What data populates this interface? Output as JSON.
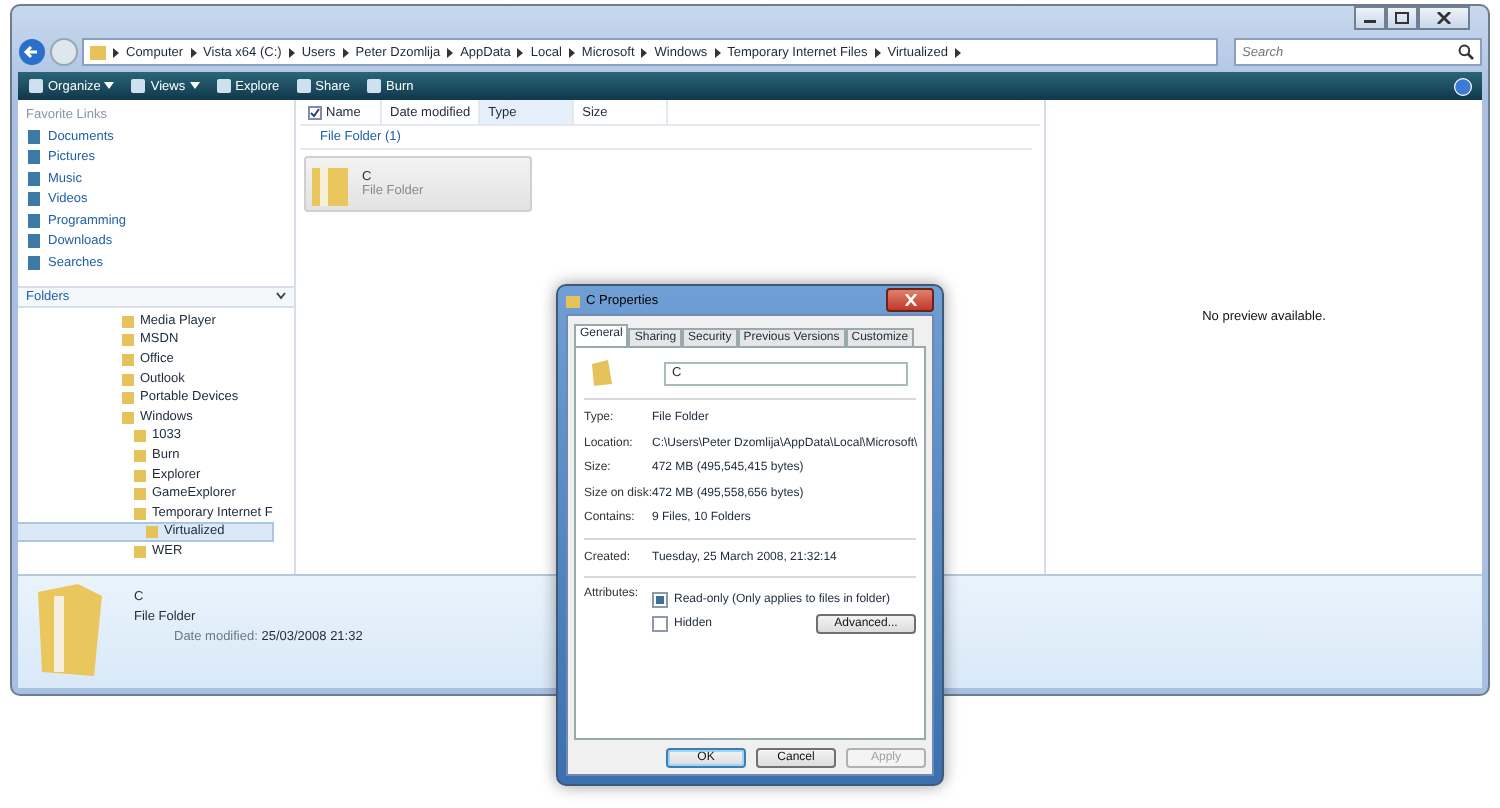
{
  "window": {
    "breadcrumbs": [
      "Computer",
      "Vista x64 (C:)",
      "Users",
      "Peter Dzomlija",
      "AppData",
      "Local",
      "Microsoft",
      "Windows",
      "Temporary Internet Files",
      "Virtualized"
    ],
    "search": {
      "placeholder": "Search"
    }
  },
  "toolbar": [
    {
      "label": "Organize",
      "dropdown": true
    },
    {
      "label": "Views",
      "dropdown": true
    },
    {
      "label": "Explore",
      "dropdown": false
    },
    {
      "label": "Share",
      "dropdown": false
    },
    {
      "label": "Burn",
      "dropdown": false
    }
  ],
  "sidebar": {
    "favorites_title": "Favorite Links",
    "favorites": [
      "Documents",
      "Pictures",
      "Music",
      "Videos",
      "Programming",
      "Downloads",
      "Searches"
    ],
    "folders_title": "Folders",
    "folders": [
      {
        "label": "Media Player",
        "selected": false
      },
      {
        "label": "MSDN",
        "selected": false
      },
      {
        "label": "Office",
        "selected": false
      },
      {
        "label": "Outlook",
        "selected": false
      },
      {
        "label": "Portable Devices",
        "selected": false
      },
      {
        "label": "Windows",
        "selected": false,
        "children": [
          {
            "label": "1033",
            "selected": false
          },
          {
            "label": "Burn",
            "selected": false
          },
          {
            "label": "Explorer",
            "selected": false
          },
          {
            "label": "GameExplorer",
            "selected": false
          },
          {
            "label": "Temporary Internet F",
            "selected": false,
            "children": [
              {
                "label": "Virtualized",
                "selected": true
              }
            ]
          },
          {
            "label": "WER",
            "selected": false
          }
        ]
      }
    ]
  },
  "table": {
    "columns": [
      {
        "label": "Name",
        "sorted": false
      },
      {
        "label": "Date modified",
        "sorted": false
      },
      {
        "label": "Type",
        "sorted": true
      },
      {
        "label": "Size",
        "sorted": false
      }
    ],
    "group": "File Folder (1)",
    "items": [
      {
        "name": "C",
        "type": "File Folder",
        "selected": true
      }
    ]
  },
  "preview": "No preview available.",
  "details": {
    "name": "C",
    "type": "File Folder",
    "date_label": "Date modified:",
    "date": "25/03/2008 21:32"
  },
  "dialog": {
    "title": "C Properties",
    "tabs": [
      {
        "label": "General",
        "selected": true
      },
      {
        "label": "Sharing",
        "selected": false
      },
      {
        "label": "Security",
        "selected": false
      },
      {
        "label": "Previous Versions",
        "selected": false
      },
      {
        "label": "Customize",
        "selected": false
      }
    ],
    "name_value": "C",
    "sections": [
      [
        {
          "label": "Type:",
          "value": "File Folder"
        },
        {
          "label": "Location:",
          "value": "C:\\Users\\Peter Dzomlija\\AppData\\Local\\Microsoft\\"
        },
        {
          "label": "Size:",
          "value": "472 MB (495,545,415 bytes)"
        },
        {
          "label": "Size on disk:",
          "value": "472 MB (495,558,656 bytes)"
        },
        {
          "label": "Contains:",
          "value": "9 Files, 10 Folders"
        }
      ],
      [
        {
          "label": "Created:",
          "value": "Tuesday, 25 March 2008, 21:32:14"
        }
      ]
    ],
    "attributes_label": "Attributes:",
    "attributes": [
      {
        "label": "Read-only (Only applies to files in folder)",
        "checked": true
      },
      {
        "label": "Hidden",
        "checked": false
      }
    ],
    "advanced": "Advanced...",
    "buttons": [
      {
        "label": "OK",
        "disabled": false,
        "default": true
      },
      {
        "label": "Cancel",
        "disabled": false,
        "default": false
      },
      {
        "label": "Apply",
        "disabled": true,
        "default": false
      }
    ]
  }
}
